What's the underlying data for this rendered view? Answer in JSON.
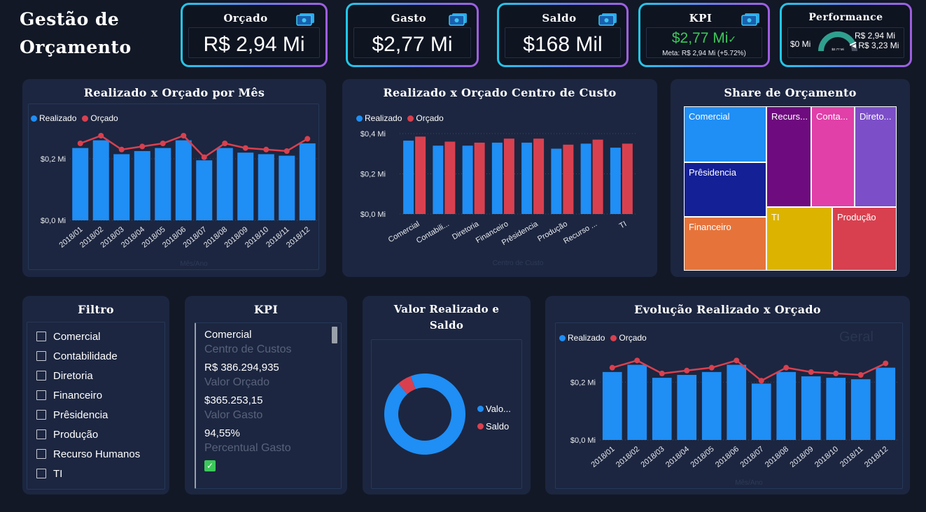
{
  "header": {
    "title_line1": "Gestão de",
    "title_line2": "Orçamento"
  },
  "kpis": {
    "orcado": {
      "caption": "Orçado",
      "value": "R$ 2,94 Mi"
    },
    "gasto": {
      "caption": "Gasto",
      "value": "$2,77 Mi"
    },
    "saldo": {
      "caption": "Saldo",
      "value": "$168 Mil"
    },
    "kpi": {
      "caption": "KPI",
      "value": "$2,77 Mi",
      "meta": "Meta: R$ 2,94 Mi (+5.72%)"
    },
    "performance": {
      "caption": "Performance",
      "min": "$0 Mi",
      "center": "$2.77 Mi",
      "target": "R$ 2,94 Mi",
      "max": "R$ 3,23 Mi",
      "fraction": 0.857
    }
  },
  "colors": {
    "realizado": "#1f8ef5",
    "orcado": "#d9404f",
    "accent_green": "#3cc85a"
  },
  "monthly": {
    "title": "Realizado x Orçado por Mês",
    "legend": [
      "Realizado",
      "Orçado"
    ],
    "xlabel": "Mês/Ano",
    "yticks": [
      "$0,2 Mi",
      "$0,0 Mi"
    ]
  },
  "costcenter": {
    "title": "Realizado x Orçado Centro de Custo",
    "legend": [
      "Realizado",
      "Orçado"
    ],
    "xlabel": "Centro de Custo",
    "yticks": [
      "$0,4 Mi",
      "$0,2 Mi",
      "$0,0 Mi"
    ]
  },
  "share": {
    "title": "Share de Orçamento",
    "cells": [
      "Comercial",
      "Recurs...",
      "Conta...",
      "Direto...",
      "Prêsidencia",
      "Financeiro",
      "TI",
      "Produção"
    ]
  },
  "filtro": {
    "title": "Filtro",
    "items": [
      "Comercial",
      "Contabilidade",
      "Diretoria",
      "Financeiro",
      "Prêsidencia",
      "Produção",
      "Recurso Humanos",
      "TI"
    ]
  },
  "kpi_card": {
    "title": "KPI",
    "rows": [
      {
        "value": "Comercial",
        "label": "Centro de Custos"
      },
      {
        "value": "R$ 386.294,935",
        "label": "Valor Orçado"
      },
      {
        "value": "$365.253,15",
        "label": "Valor Gasto"
      },
      {
        "value": "94,55%",
        "label": "Percentual Gasto"
      }
    ]
  },
  "donut": {
    "title_line1": "Valor Realizado e",
    "title_line2": "Saldo",
    "legend": [
      "Valo...",
      "Saldo"
    ]
  },
  "evolution": {
    "title": "Evolução Realizado x Orçado",
    "legend": [
      "Realizado",
      "Orçado"
    ],
    "watermark": "Geral",
    "xlabel": "Mês/Ano",
    "yticks": [
      "$0,2 Mi",
      "$0,0 Mi"
    ]
  },
  "chart_data": [
    {
      "type": "bar",
      "title": "Realizado x Orçado por Mês",
      "categories": [
        "2018/01",
        "2018/02",
        "2018/03",
        "2018/04",
        "2018/05",
        "2018/06",
        "2018/07",
        "2018/08",
        "2018/09",
        "2018/10",
        "2018/11",
        "2018/12"
      ],
      "series": [
        {
          "name": "Realizado",
          "type": "bar",
          "values": [
            0.235,
            0.26,
            0.215,
            0.225,
            0.235,
            0.26,
            0.195,
            0.235,
            0.22,
            0.215,
            0.21,
            0.25
          ]
        },
        {
          "name": "Orçado",
          "type": "line",
          "values": [
            0.25,
            0.275,
            0.23,
            0.24,
            0.25,
            0.275,
            0.205,
            0.25,
            0.235,
            0.23,
            0.225,
            0.265
          ]
        }
      ],
      "ylim": [
        0,
        0.3
      ]
    },
    {
      "type": "bar",
      "title": "Realizado x Orçado Centro de Custo",
      "categories": [
        "Comercial",
        "Contabili...",
        "Diretoria",
        "Financeiro",
        "Prêsidencia",
        "Produção",
        "Recurso ...",
        "TI"
      ],
      "series": [
        {
          "name": "Realizado",
          "values": [
            0.365,
            0.34,
            0.34,
            0.355,
            0.355,
            0.325,
            0.35,
            0.33
          ]
        },
        {
          "name": "Orçado",
          "values": [
            0.385,
            0.36,
            0.355,
            0.375,
            0.375,
            0.345,
            0.37,
            0.35
          ]
        }
      ],
      "ylim": [
        0,
        0.4
      ]
    },
    {
      "type": "pie",
      "title": "Valor Realizado e Saldo",
      "categories": [
        "Valor Realizado",
        "Saldo"
      ],
      "values": [
        2.77,
        0.168
      ]
    },
    {
      "type": "bar",
      "title": "Evolução Realizado x Orçado",
      "categories": [
        "2018/01",
        "2018/02",
        "2018/03",
        "2018/04",
        "2018/05",
        "2018/06",
        "2018/07",
        "2018/08",
        "2018/09",
        "2018/10",
        "2018/11",
        "2018/12"
      ],
      "series": [
        {
          "name": "Realizado",
          "type": "bar",
          "values": [
            0.235,
            0.26,
            0.215,
            0.225,
            0.235,
            0.26,
            0.195,
            0.235,
            0.22,
            0.215,
            0.21,
            0.25
          ]
        },
        {
          "name": "Orçado",
          "type": "line",
          "values": [
            0.25,
            0.275,
            0.23,
            0.24,
            0.25,
            0.275,
            0.205,
            0.25,
            0.235,
            0.23,
            0.225,
            0.265
          ]
        }
      ],
      "ylim": [
        0,
        0.3
      ]
    }
  ]
}
